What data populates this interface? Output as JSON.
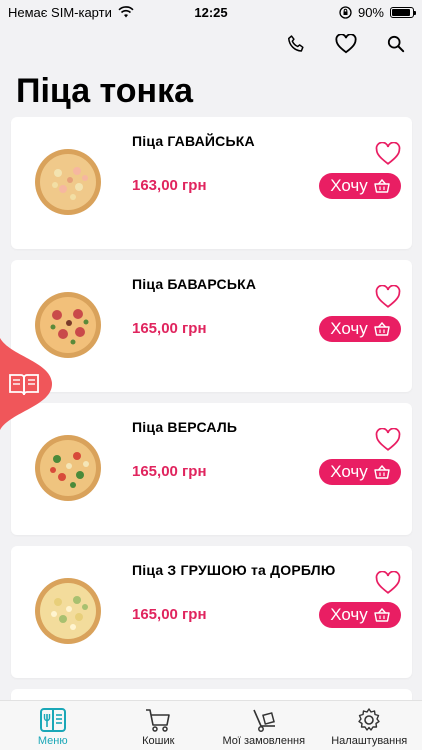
{
  "status_bar": {
    "carrier": "Немає SIM-карти",
    "time": "12:25",
    "battery": "90%",
    "battery_level": 0.9
  },
  "header": {
    "title": "Піца тонка",
    "icons": [
      "phone-icon",
      "heart-icon",
      "search-icon"
    ]
  },
  "products": [
    {
      "name": "Піца ГАВАЙСЬКА",
      "price": "163,00 грн",
      "button_label": "Хочу"
    },
    {
      "name": "Піца БАВАРСЬКА",
      "price": "165,00 грн",
      "button_label": "Хочу"
    },
    {
      "name": "Піца ВЕРСАЛЬ",
      "price": "165,00 грн",
      "button_label": "Хочу"
    },
    {
      "name": "Піца З ГРУШОЮ та ДОРБЛЮ",
      "price": "165,00 грн",
      "button_label": "Хочу"
    }
  ],
  "bottom_nav": {
    "items": [
      {
        "label": "Меню",
        "icon": "menu-book-icon",
        "active": true
      },
      {
        "label": "Кошик",
        "icon": "cart-icon",
        "active": false
      },
      {
        "label": "Мої замовлення",
        "icon": "hand-truck-icon",
        "active": false
      },
      {
        "label": "Налаштування",
        "icon": "gear-icon",
        "active": false
      }
    ]
  },
  "colors": {
    "accent": "#e91e63",
    "price": "#e0245e",
    "nav_active": "#1aa7b7",
    "side_tab": "#f0565a"
  }
}
